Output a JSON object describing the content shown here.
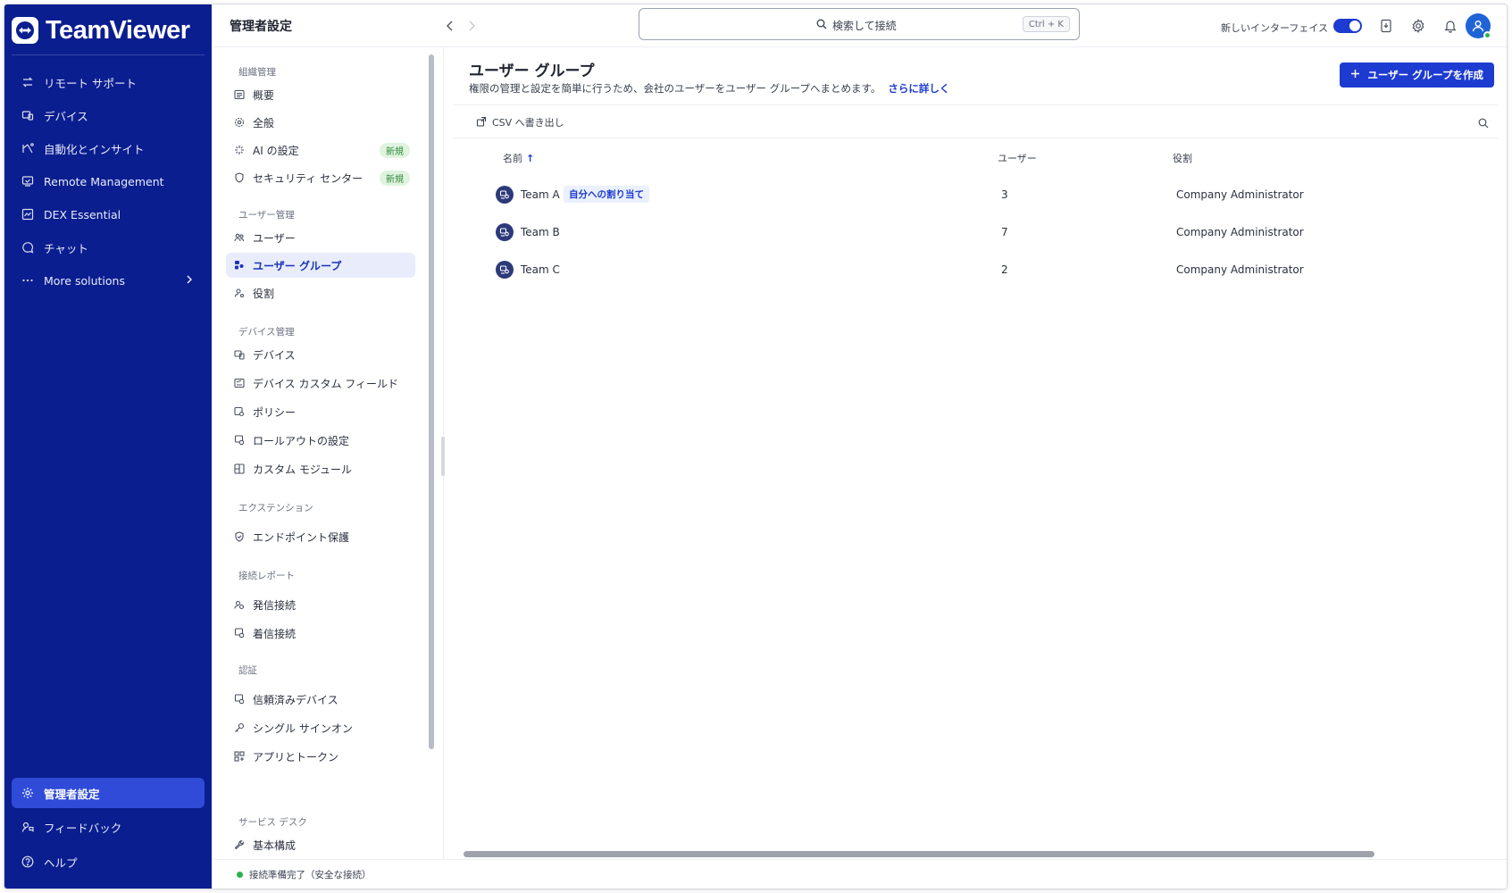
{
  "brand": {
    "name": "TeamViewer"
  },
  "leftnav": {
    "items": [
      {
        "label": "リモート サポート",
        "icon": "arrows-swap-icon"
      },
      {
        "label": "デバイス",
        "icon": "devices-icon"
      },
      {
        "label": "自動化とインサイト",
        "icon": "automation-icon"
      },
      {
        "label": "Remote Management",
        "icon": "remote-management-icon"
      },
      {
        "label": "DEX Essential",
        "icon": "dex-icon"
      },
      {
        "label": "チャット",
        "icon": "chat-icon"
      },
      {
        "label": "More solutions",
        "icon": "more-icon"
      }
    ],
    "bottom": [
      {
        "label": "管理者設定",
        "icon": "admin-gear-icon",
        "active": true
      },
      {
        "label": "フィードバック",
        "icon": "feedback-icon"
      },
      {
        "label": "ヘルプ",
        "icon": "help-icon"
      }
    ]
  },
  "topbar": {
    "title": "管理者設定",
    "search_placeholder": "検索して接続",
    "search_shortcut": "Ctrl + K",
    "new_ui_label": "新しいインターフェイス",
    "new_ui_enabled": true
  },
  "settings": {
    "sections": [
      {
        "title": "組織管理",
        "items": [
          {
            "label": "概要",
            "icon": "overview-icon"
          },
          {
            "label": "全般",
            "icon": "gear-icon"
          },
          {
            "label": "AI の設定",
            "icon": "sparkle-icon",
            "badge": "新規"
          },
          {
            "label": "セキュリティ センター",
            "icon": "shield-icon",
            "badge": "新規"
          }
        ]
      },
      {
        "title": "ユーザー管理",
        "items": [
          {
            "label": "ユーザー",
            "icon": "users-icon"
          },
          {
            "label": "ユーザー グループ",
            "icon": "user-group-icon",
            "active": true
          },
          {
            "label": "役割",
            "icon": "role-icon"
          }
        ]
      },
      {
        "title": "デバイス管理",
        "items": [
          {
            "label": "デバイス",
            "icon": "device-icon"
          },
          {
            "label": "デバイス カスタム フィールド",
            "icon": "custom-field-icon"
          },
          {
            "label": "ポリシー",
            "icon": "policy-icon"
          },
          {
            "label": "ロールアウトの設定",
            "icon": "rollout-icon"
          },
          {
            "label": "カスタム モジュール",
            "icon": "module-icon"
          }
        ]
      },
      {
        "title": "エクステンション",
        "items": [
          {
            "label": "エンドポイント保護",
            "icon": "endpoint-shield-icon"
          }
        ]
      },
      {
        "title": "接続レポート",
        "items": [
          {
            "label": "発信接続",
            "icon": "outgoing-icon"
          },
          {
            "label": "着信接続",
            "icon": "incoming-icon"
          }
        ]
      },
      {
        "title": "認証",
        "items": [
          {
            "label": "信頼済みデバイス",
            "icon": "trusted-device-icon"
          },
          {
            "label": "シングル サインオン",
            "icon": "key-icon"
          },
          {
            "label": "アプリとトークン",
            "icon": "apps-icon"
          }
        ]
      },
      {
        "title": "サービス デスク",
        "items": [
          {
            "label": "基本構成",
            "icon": "wrench-icon"
          }
        ]
      }
    ]
  },
  "main": {
    "title": "ユーザー グループ",
    "description": "権限の管理と設定を簡単に行うため、会社のユーザーをユーザー グループへまとめます。",
    "learn_more": "さらに詳しく",
    "create_button": "ユーザー グループを作成",
    "csv_export": "CSV へ書き出し",
    "columns": {
      "name": "名前",
      "users": "ユーザー",
      "role": "役割"
    },
    "sort_indicator": "↑",
    "rows": [
      {
        "name": "Team A",
        "tag": "自分への割り当て",
        "users": "3",
        "role": "Company Administrator"
      },
      {
        "name": "Team B",
        "tag": "",
        "users": "7",
        "role": "Company Administrator"
      },
      {
        "name": "Team C",
        "tag": "",
        "users": "2",
        "role": "Company Administrator"
      }
    ]
  },
  "status": {
    "text": "接続準備完了（安全な接続）"
  },
  "colors": {
    "nav_bg": "#0b1e8f",
    "accent": "#1d3bd1",
    "active_nav": "#2f4bd8",
    "online": "#2bb24c",
    "new_badge_bg": "#dff3df"
  }
}
